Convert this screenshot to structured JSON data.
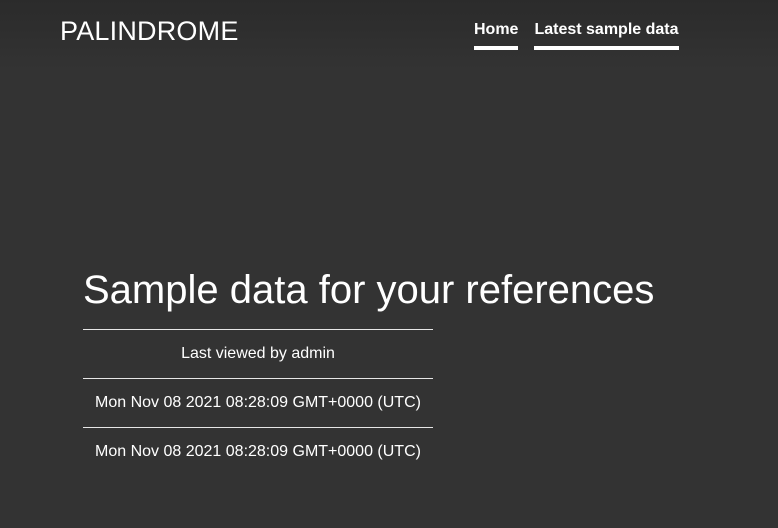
{
  "header": {
    "brand": "PALINDROME",
    "nav": [
      {
        "label": "Home"
      },
      {
        "label": "Latest sample data"
      }
    ]
  },
  "main": {
    "title": "Sample data for your references",
    "rows": [
      "Last viewed by admin",
      "Mon Nov 08 2021 08:28:09 GMT+0000 (UTC)",
      "Mon Nov 08 2021 08:28:09 GMT+0000 (UTC)"
    ]
  },
  "colors": {
    "background": "#333333",
    "text": "#ffffff",
    "divider": "#e6e6e6"
  }
}
